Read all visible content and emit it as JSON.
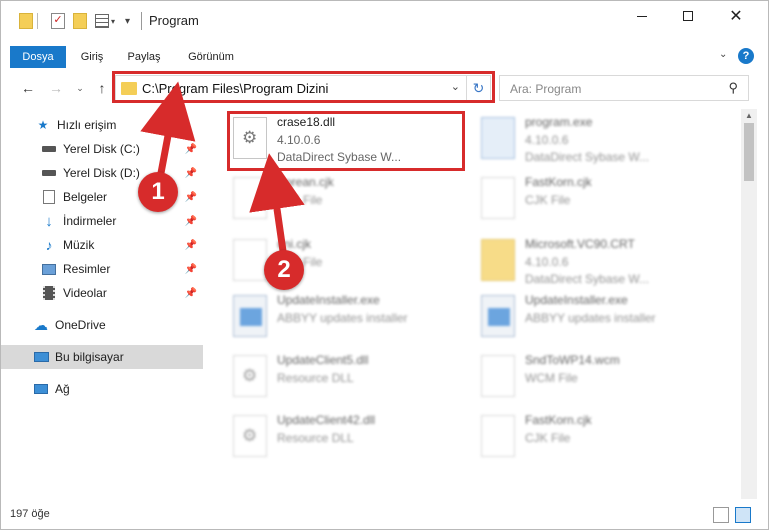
{
  "window": {
    "title": "Program"
  },
  "ribbon": {
    "tabs": [
      "Dosya",
      "Giriş",
      "Paylaş",
      "Görünüm"
    ]
  },
  "address": {
    "path": "C:\\Program Files\\Program Dizini"
  },
  "search": {
    "placeholder": "Ara: Program"
  },
  "sidebar": {
    "items": [
      {
        "label": "Hızlı erişim",
        "icon": "star-icon"
      },
      {
        "label": "Yerel Disk (C:)",
        "icon": "drive-icon",
        "pinned": true
      },
      {
        "label": "Yerel Disk (D:)",
        "icon": "drive-icon",
        "pinned": true
      },
      {
        "label": "Belgeler",
        "icon": "documents-icon",
        "pinned": true
      },
      {
        "label": "İndirmeler",
        "icon": "download-icon",
        "pinned": true
      },
      {
        "label": "Müzik",
        "icon": "music-icon",
        "pinned": true
      },
      {
        "label": "Resimler",
        "icon": "pictures-icon",
        "pinned": true
      },
      {
        "label": "Videolar",
        "icon": "video-icon",
        "pinned": true
      },
      {
        "label": "OneDrive",
        "icon": "cloud-icon"
      },
      {
        "label": "Bu bilgisayar",
        "icon": "computer-icon",
        "selected": true
      },
      {
        "label": "Ağ",
        "icon": "network-icon"
      }
    ]
  },
  "files": [
    {
      "name": "crase18.dll",
      "version": "4.10.0.6",
      "desc": "DataDirect Sybase W...",
      "type": "gear",
      "highlight": true
    },
    {
      "name": "program.exe",
      "version": "4.10.0.6",
      "desc": "DataDirect Sybase W...",
      "type": "exe"
    },
    {
      "name": "Korean.cjk",
      "version": "",
      "desc": "CJK File",
      "type": "plain"
    },
    {
      "name": "FastKorn.cjk",
      "version": "",
      "desc": "CJK File",
      "type": "plain"
    },
    {
      "name": "uni.cjk",
      "version": "",
      "desc": "CJK File",
      "type": "plain"
    },
    {
      "name": "Microsoft.VC90.CRT",
      "version": "4.10.0.6",
      "desc": "DataDirect Sybase W...",
      "type": "zip"
    },
    {
      "name": "UpdateInstaller.exe",
      "version": "",
      "desc": "ABBYY updates installer",
      "type": "installer"
    },
    {
      "name": "UpdateInstaller.exe",
      "version": "",
      "desc": "ABBYY updates installer",
      "type": "installer"
    },
    {
      "name": "UpdateClient5.dll",
      "version": "",
      "desc": "Resource DLL",
      "type": "gear"
    },
    {
      "name": "SndToWP14.wcm",
      "version": "",
      "desc": "WCM File",
      "type": "plain"
    },
    {
      "name": "UpdateClient42.dll",
      "version": "",
      "desc": "Resource DLL",
      "type": "gear"
    },
    {
      "name": "FastKorn.cjk",
      "version": "",
      "desc": "CJK File",
      "type": "plain"
    }
  ],
  "status": {
    "count": "197 öğe"
  },
  "annotations": {
    "step1": "1",
    "step2": "2",
    "color": "#d72b2b"
  }
}
